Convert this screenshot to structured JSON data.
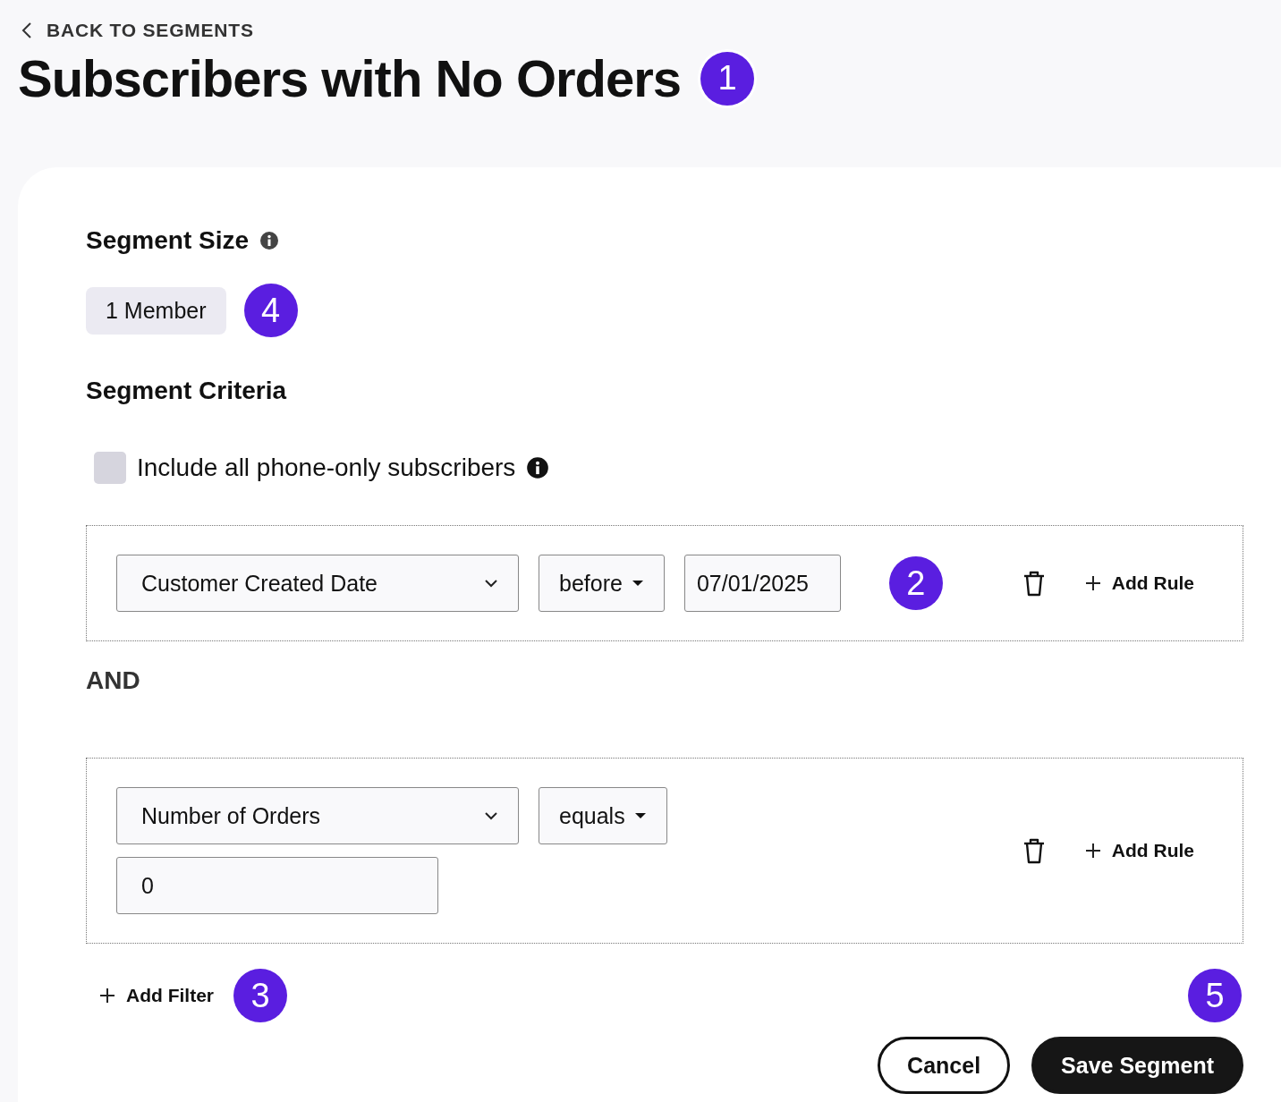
{
  "back_link": {
    "label": "BACK TO SEGMENTS"
  },
  "title": {
    "text": "Subscribers with No Orders",
    "badge": "1"
  },
  "segment_size": {
    "heading": "Segment Size",
    "count": "1 Member",
    "badge": "4"
  },
  "criteria": {
    "heading": "Segment Criteria",
    "phone_only": {
      "label": "Include all phone-only subscribers",
      "checked": false
    }
  },
  "filters": [
    {
      "kind": "inline",
      "field": "Customer Created Date",
      "operator": "before",
      "value": "07/01/2025",
      "badge": "2",
      "add_rule": "Add Rule"
    },
    {
      "kind": "stacked",
      "field": "Number of Orders",
      "operator": "equals",
      "value": "0",
      "add_rule": "Add Rule"
    }
  ],
  "and_label": "AND",
  "add_filter": {
    "label": "Add Filter",
    "badge": "3"
  },
  "footer_badge": "5",
  "buttons": [
    {
      "kind": "secondary",
      "label": "Cancel"
    },
    {
      "kind": "primary",
      "label": "Save Segment"
    }
  ]
}
